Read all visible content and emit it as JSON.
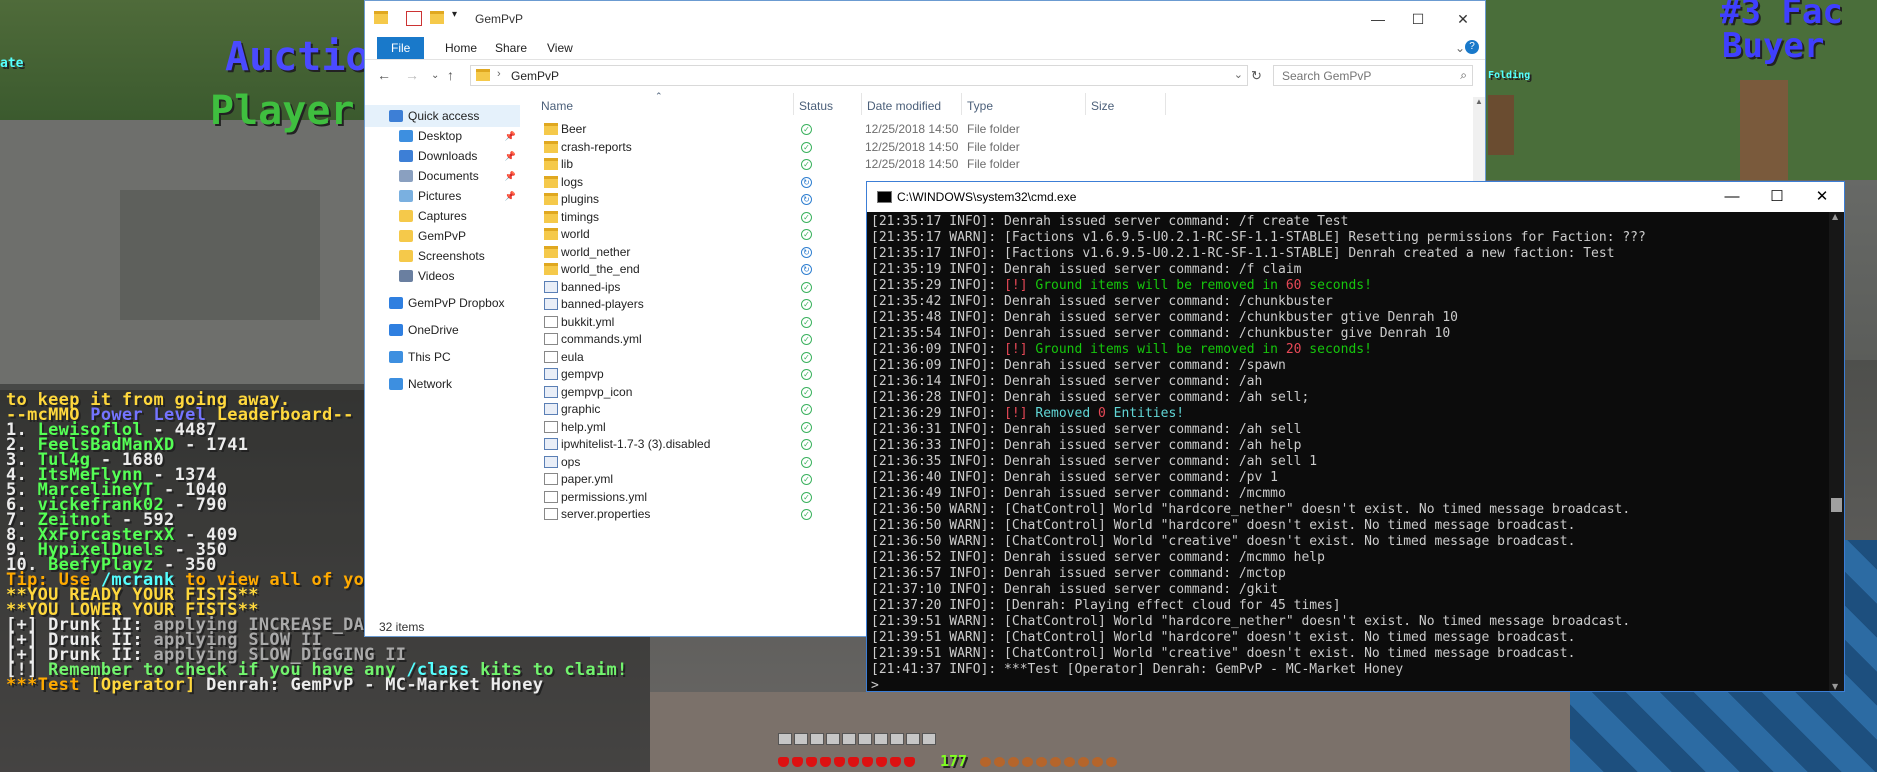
{
  "game": {
    "signs": [
      "Auction",
      "Player",
      "#3 Fac",
      "Buyer",
      "ate",
      "Folding"
    ],
    "chat": [
      {
        "text": "to keep it from going away.",
        "color": "yel"
      },
      {
        "parts": [
          {
            "t": "--mcMMO ",
            "c": "yel"
          },
          {
            "t": "Power Level",
            "c": "blu"
          },
          {
            "t": " Leaderboard--",
            "c": "yel"
          }
        ]
      },
      {
        "parts": [
          {
            "t": "1. ",
            "c": "wh"
          },
          {
            "t": "Lewisoflol",
            "c": "grn"
          },
          {
            "t": " - 4487",
            "c": "wh"
          }
        ]
      },
      {
        "parts": [
          {
            "t": "2. ",
            "c": "wh"
          },
          {
            "t": "FeelsBadManXD",
            "c": "grn"
          },
          {
            "t": " - 1741",
            "c": "wh"
          }
        ]
      },
      {
        "parts": [
          {
            "t": "3. ",
            "c": "wh"
          },
          {
            "t": "Tul4g",
            "c": "grn"
          },
          {
            "t": " - 1680",
            "c": "wh"
          }
        ]
      },
      {
        "parts": [
          {
            "t": "4. ",
            "c": "wh"
          },
          {
            "t": "ItsMeFlynn",
            "c": "grn"
          },
          {
            "t": " - 1374",
            "c": "wh"
          }
        ]
      },
      {
        "parts": [
          {
            "t": "5. ",
            "c": "wh"
          },
          {
            "t": "MarcelineYT",
            "c": "grn"
          },
          {
            "t": " - 1040",
            "c": "wh"
          }
        ]
      },
      {
        "parts": [
          {
            "t": "6. ",
            "c": "wh"
          },
          {
            "t": "vickefrank02",
            "c": "grn"
          },
          {
            "t": " - 790",
            "c": "wh"
          }
        ]
      },
      {
        "parts": [
          {
            "t": "7. ",
            "c": "wh"
          },
          {
            "t": "Zeitnot",
            "c": "grn"
          },
          {
            "t": " - 592",
            "c": "wh"
          }
        ]
      },
      {
        "parts": [
          {
            "t": "8. ",
            "c": "wh"
          },
          {
            "t": "XxForcasterxX",
            "c": "grn"
          },
          {
            "t": " - 409",
            "c": "wh"
          }
        ]
      },
      {
        "parts": [
          {
            "t": "9. ",
            "c": "wh"
          },
          {
            "t": "HypixelDuels",
            "c": "grn"
          },
          {
            "t": " - 350",
            "c": "wh"
          }
        ]
      },
      {
        "parts": [
          {
            "t": "10. ",
            "c": "wh"
          },
          {
            "t": "BeefyPlayz",
            "c": "grn"
          },
          {
            "t": " - 350",
            "c": "wh"
          }
        ]
      },
      {
        "parts": [
          {
            "t": "Tip: Use ",
            "c": "orn"
          },
          {
            "t": "/mcrank",
            "c": "cya"
          },
          {
            "t": " to view all of your",
            "c": "orn"
          }
        ]
      },
      {
        "text": "**YOU READY YOUR FISTS**",
        "color": "yel"
      },
      {
        "text": "**YOU LOWER YOUR FISTS**",
        "color": "yel"
      },
      {
        "parts": [
          {
            "t": "[+] Drunk II: ",
            "c": "wh"
          },
          {
            "t": "applying INCREASE_DAMAGE II",
            "c": "gry"
          }
        ]
      },
      {
        "parts": [
          {
            "t": "[+] Drunk II: ",
            "c": "wh"
          },
          {
            "t": "applying SLOW II",
            "c": "gry"
          }
        ]
      },
      {
        "parts": [
          {
            "t": "[+] Drunk II: ",
            "c": "wh"
          },
          {
            "t": "applying SLOW_DIGGING II",
            "c": "gry"
          }
        ]
      },
      {
        "parts": [
          {
            "t": "[!] ",
            "c": "wh"
          },
          {
            "t": "Remember to check if you have any ",
            "c": "lgrn"
          },
          {
            "t": "/class",
            "c": "cya"
          },
          {
            "t": " kits to claim!",
            "c": "lgrn"
          }
        ]
      },
      {
        "parts": [
          {
            "t": "***Test ",
            "c": "orn"
          },
          {
            "t": "[Operator]",
            "c": "yel"
          },
          {
            "t": " Denrah: GemPvP - MC-Market Honey",
            "c": "wh"
          }
        ]
      }
    ],
    "xp_level": "177"
  },
  "explorer": {
    "title": "GemPvP",
    "tabs": {
      "file": "File",
      "home": "Home",
      "share": "Share",
      "view": "View"
    },
    "address": "GemPvP",
    "search_placeholder": "Search GemPvP",
    "columns": {
      "name": "Name",
      "status": "Status",
      "date": "Date modified",
      "type": "Type",
      "size": "Size"
    },
    "nav": [
      {
        "label": "Quick access",
        "icon": "star-icon"
      },
      {
        "label": "Desktop",
        "icon": "desktop-icon",
        "pinned": true
      },
      {
        "label": "Downloads",
        "icon": "download-icon",
        "pinned": true
      },
      {
        "label": "Documents",
        "icon": "document-icon",
        "pinned": true
      },
      {
        "label": "Pictures",
        "icon": "pictures-icon",
        "pinned": true
      },
      {
        "label": "Captures",
        "icon": "folder-icon"
      },
      {
        "label": "GemPvP",
        "icon": "folder-icon"
      },
      {
        "label": "Screenshots",
        "icon": "folder-icon"
      },
      {
        "label": "Videos",
        "icon": "video-icon"
      },
      {
        "label": "GemPvP Dropbox",
        "icon": "dropbox-icon"
      },
      {
        "label": "OneDrive",
        "icon": "cloud-icon"
      },
      {
        "label": "This PC",
        "icon": "pc-icon"
      },
      {
        "label": "Network",
        "icon": "network-icon"
      }
    ],
    "files": [
      {
        "name": "Beer",
        "kind": "folder",
        "status": "ok",
        "date": "12/25/2018 14:50",
        "type": "File folder"
      },
      {
        "name": "crash-reports",
        "kind": "folder",
        "status": "ok",
        "date": "12/25/2018 14:50",
        "type": "File folder"
      },
      {
        "name": "lib",
        "kind": "folder",
        "status": "ok",
        "date": "12/25/2018 14:50",
        "type": "File folder"
      },
      {
        "name": "logs",
        "kind": "folder",
        "status": "sync",
        "date": "",
        "type": ""
      },
      {
        "name": "plugins",
        "kind": "folder",
        "status": "sync",
        "date": "",
        "type": ""
      },
      {
        "name": "timings",
        "kind": "folder",
        "status": "ok",
        "date": "",
        "type": ""
      },
      {
        "name": "world",
        "kind": "folder",
        "status": "ok",
        "date": "",
        "type": ""
      },
      {
        "name": "world_nether",
        "kind": "folder",
        "status": "sync",
        "date": "",
        "type": ""
      },
      {
        "name": "world_the_end",
        "kind": "folder",
        "status": "sync",
        "date": "",
        "type": ""
      },
      {
        "name": "banned-ips",
        "kind": "file2",
        "status": "ok",
        "date": "",
        "type": ""
      },
      {
        "name": "banned-players",
        "kind": "file2",
        "status": "ok",
        "date": "",
        "type": ""
      },
      {
        "name": "bukkit.yml",
        "kind": "file",
        "status": "ok",
        "date": "",
        "type": ""
      },
      {
        "name": "commands.yml",
        "kind": "file",
        "status": "ok",
        "date": "",
        "type": ""
      },
      {
        "name": "eula",
        "kind": "file",
        "status": "ok",
        "date": "",
        "type": ""
      },
      {
        "name": "gempvp",
        "kind": "file2",
        "status": "ok",
        "date": "",
        "type": ""
      },
      {
        "name": "gempvp_icon",
        "kind": "file2",
        "status": "ok",
        "date": "",
        "type": ""
      },
      {
        "name": "graphic",
        "kind": "file2",
        "status": "ok",
        "date": "",
        "type": ""
      },
      {
        "name": "help.yml",
        "kind": "file",
        "status": "ok",
        "date": "",
        "type": ""
      },
      {
        "name": "ipwhitelist-1.7-3 (3).disabled",
        "kind": "file2",
        "status": "ok",
        "date": "",
        "type": ""
      },
      {
        "name": "ops",
        "kind": "file2",
        "status": "ok",
        "date": "",
        "type": ""
      },
      {
        "name": "paper.yml",
        "kind": "file",
        "status": "ok",
        "date": "",
        "type": ""
      },
      {
        "name": "permissions.yml",
        "kind": "file",
        "status": "ok",
        "date": "",
        "type": ""
      },
      {
        "name": "server.properties",
        "kind": "file",
        "status": "ok",
        "date": "",
        "type": ""
      }
    ],
    "status_text": "32 items"
  },
  "cmd": {
    "title": "C:\\WINDOWS\\system32\\cmd.exe",
    "lines": [
      [
        {
          "t": "[21:35:17 INFO]: Denrah issued server command: /f create Test"
        }
      ],
      [
        {
          "t": "[21:35:17 WARN]: [Factions v1.6.9.5-U0.2.1-RC-SF-1.1-STABLE] Resetting permissions for Faction: ???"
        }
      ],
      [
        {
          "t": "[21:35:17 INFO]: [Factions v1.6.9.5-U0.2.1-RC-SF-1.1-STABLE] Denrah created a new faction: Test"
        }
      ],
      [
        {
          "t": "[21:35:19 INFO]: Denrah issued server command: /f claim"
        }
      ],
      [
        {
          "t": "[21:35:29 INFO]: "
        },
        {
          "t": "[!] ",
          "c": "r"
        },
        {
          "t": "Ground items will be removed in ",
          "c": "g"
        },
        {
          "t": "60",
          "c": "r"
        },
        {
          "t": " seconds!",
          "c": "g"
        }
      ],
      [
        {
          "t": "[21:35:42 INFO]: Denrah issued server command: /chunkbuster"
        }
      ],
      [
        {
          "t": "[21:35:48 INFO]: Denrah issued server command: /chunkbuster gtive Denrah 10"
        }
      ],
      [
        {
          "t": "[21:35:54 INFO]: Denrah issued server command: /chunkbuster give Denrah 10"
        }
      ],
      [
        {
          "t": "[21:36:09 INFO]: "
        },
        {
          "t": "[!] ",
          "c": "r"
        },
        {
          "t": "Ground items will be removed in ",
          "c": "g"
        },
        {
          "t": "20",
          "c": "r"
        },
        {
          "t": " seconds!",
          "c": "g"
        }
      ],
      [
        {
          "t": "[21:36:09 INFO]: Denrah issued server command: /spawn"
        }
      ],
      [
        {
          "t": "[21:36:14 INFO]: Denrah issued server command: /ah"
        }
      ],
      [
        {
          "t": "[21:36:28 INFO]: Denrah issued server command: /ah sell;"
        }
      ],
      [
        {
          "t": "[21:36:29 INFO]: "
        },
        {
          "t": "[!] ",
          "c": "r"
        },
        {
          "t": "Removed ",
          "c": "c"
        },
        {
          "t": "0",
          "c": "r"
        },
        {
          "t": " Entities!",
          "c": "c"
        }
      ],
      [
        {
          "t": "[21:36:31 INFO]: Denrah issued server command: /ah sell"
        }
      ],
      [
        {
          "t": "[21:36:33 INFO]: Denrah issued server command: /ah help"
        }
      ],
      [
        {
          "t": "[21:36:35 INFO]: Denrah issued server command: /ah sell 1"
        }
      ],
      [
        {
          "t": "[21:36:40 INFO]: Denrah issued server command: /pv 1"
        }
      ],
      [
        {
          "t": "[21:36:49 INFO]: Denrah issued server command: /mcmmo"
        }
      ],
      [
        {
          "t": "[21:36:50 WARN]: [ChatControl] World \"hardcore_nether\" doesn't exist. No timed message broadcast."
        }
      ],
      [
        {
          "t": "[21:36:50 WARN]: [ChatControl] World \"hardcore\" doesn't exist. No timed message broadcast."
        }
      ],
      [
        {
          "t": "[21:36:50 WARN]: [ChatControl] World \"creative\" doesn't exist. No timed message broadcast."
        }
      ],
      [
        {
          "t": "[21:36:52 INFO]: Denrah issued server command: /mcmmo help"
        }
      ],
      [
        {
          "t": "[21:36:57 INFO]: Denrah issued server command: /mctop"
        }
      ],
      [
        {
          "t": "[21:37:10 INFO]: Denrah issued server command: /gkit"
        }
      ],
      [
        {
          "t": "[21:37:20 INFO]: [Denrah: Playing effect cloud for 45 times]"
        }
      ],
      [
        {
          "t": "[21:39:51 WARN]: [ChatControl] World \"hardcore_nether\" doesn't exist. No timed message broadcast."
        }
      ],
      [
        {
          "t": "[21:39:51 WARN]: [ChatControl] World \"hardcore\" doesn't exist. No timed message broadcast."
        }
      ],
      [
        {
          "t": "[21:39:51 WARN]: [ChatControl] World \"creative\" doesn't exist. No timed message broadcast."
        }
      ],
      [
        {
          "t": "[21:41:37 INFO]: ***Test [Operator] Denrah: GemPvP - MC-Market Honey"
        }
      ],
      [
        {
          "t": ">"
        }
      ]
    ]
  }
}
